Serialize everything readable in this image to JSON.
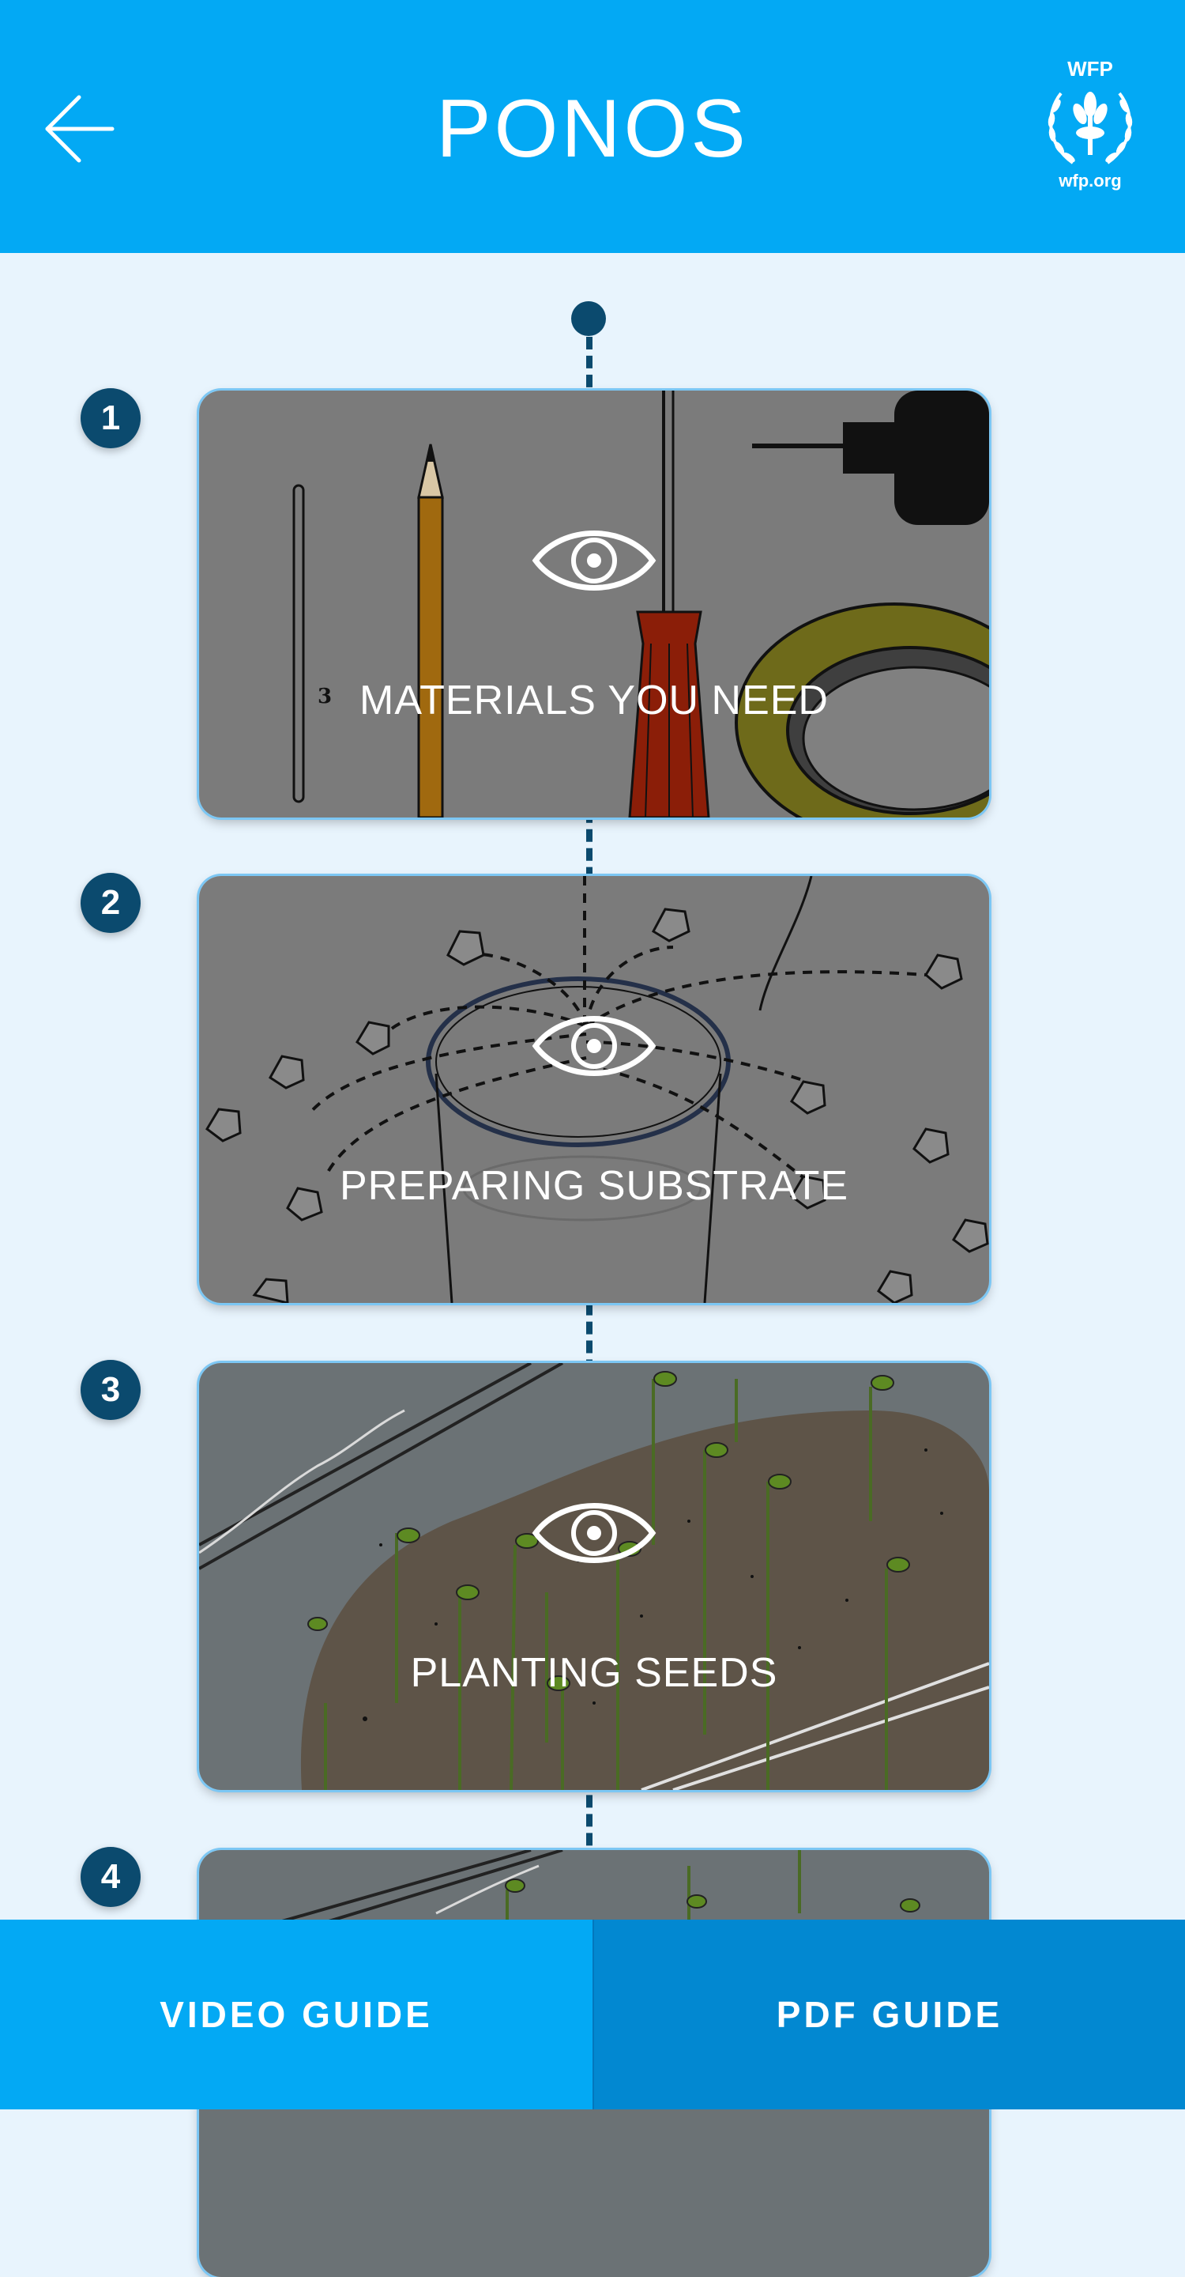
{
  "header": {
    "title": "PONOS",
    "back_icon": "arrow-left-icon",
    "logo": {
      "top_text": "WFP",
      "bottom_text": "wfp.org",
      "icon": "wfp-emblem-icon"
    }
  },
  "timeline": {
    "steps": [
      {
        "number": "1",
        "label": "MATERIALS YOU NEED",
        "icon": "eye-icon"
      },
      {
        "number": "2",
        "label": "PREPARING SUBSTRATE",
        "icon": "eye-icon"
      },
      {
        "number": "3",
        "label": "PLANTING SEEDS",
        "icon": "eye-icon"
      },
      {
        "number": "4",
        "label": "",
        "icon": "eye-icon"
      }
    ]
  },
  "bottom_bar": {
    "video_label": "VIDEO GUIDE",
    "pdf_label": "PDF GUIDE"
  },
  "colors": {
    "header_bg": "#03a9f4",
    "page_bg": "#e8f4fd",
    "badge_bg": "#0b4a6e",
    "video_btn_bg": "#03a9f4",
    "pdf_btn_bg": "#0288d1"
  }
}
